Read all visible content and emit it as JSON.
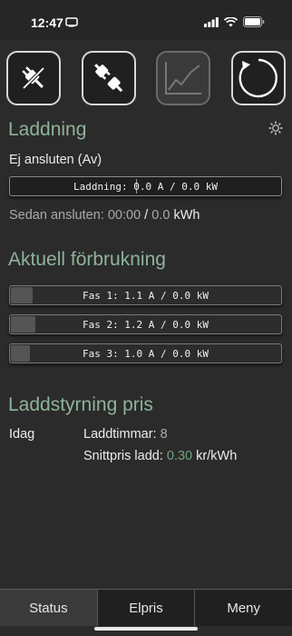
{
  "status": {
    "time": "12:47"
  },
  "top_buttons": [
    {
      "icon": "plug-disconnected-icon"
    },
    {
      "icon": "plug-connect-icon"
    },
    {
      "icon": "chart-icon"
    },
    {
      "icon": "refresh-icon"
    }
  ],
  "charging": {
    "title": "Laddning",
    "state": "Ej ansluten (Av)",
    "bar_label": "Laddning: 0.0 A / 0.0 kW",
    "since_label": "Sedan ansluten:",
    "since_time": "00:00",
    "sep": "/",
    "since_energy": "0.0",
    "unit": "kWh"
  },
  "consumption": {
    "title": "Aktuell förbrukning",
    "phases": [
      {
        "label": "Fas 1: 1.1 A / 0.0 kW",
        "level": 0.08
      },
      {
        "label": "Fas 2: 1.2 A / 0.0 kW",
        "level": 0.09
      },
      {
        "label": "Fas 3: 1.0 A / 0.0 kW",
        "level": 0.07
      }
    ]
  },
  "pricing": {
    "title": "Laddstyrning pris",
    "day": "Idag",
    "hours_label": "Laddtimmar:",
    "hours_value": "8",
    "avg_label": "Snittpris ladd:",
    "avg_value": "0.30",
    "avg_unit": "kr/kWh"
  },
  "tabs": [
    {
      "label": "Status"
    },
    {
      "label": "Elpris"
    },
    {
      "label": "Meny"
    }
  ],
  "colors": {
    "accent": "#8fb39a",
    "value_green": "#6fa37f",
    "background": "#2b2b2b"
  }
}
